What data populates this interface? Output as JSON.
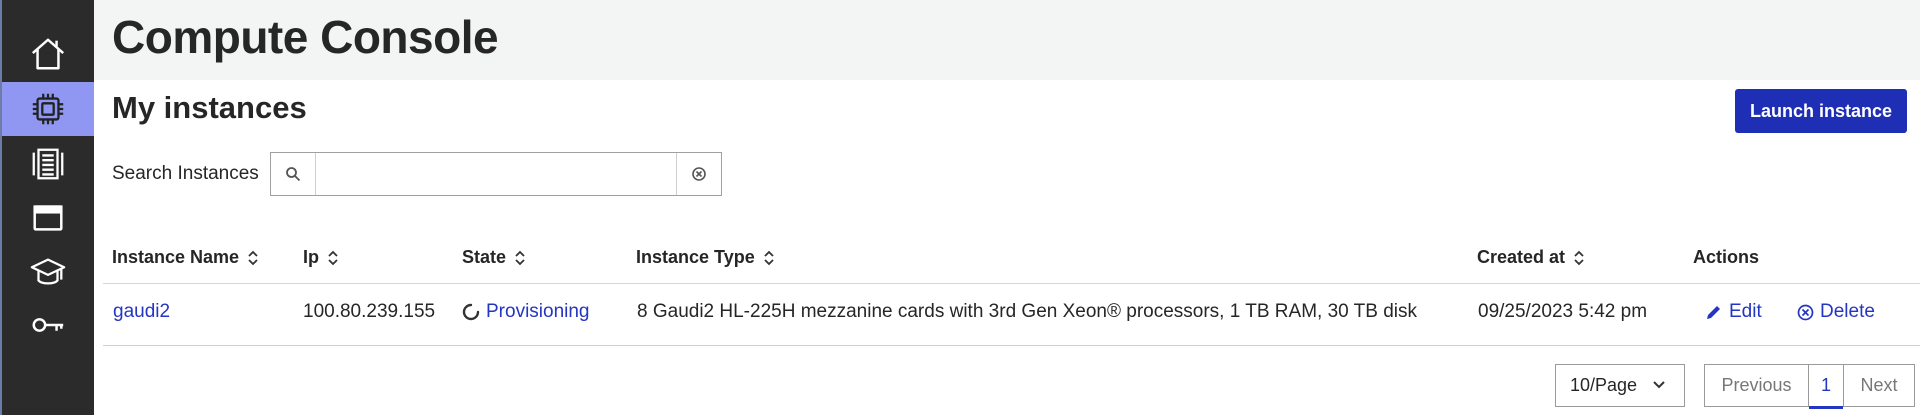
{
  "header": {
    "title": "Compute Console"
  },
  "sidebar": {
    "items": [
      {
        "name": "home",
        "icon": "home-icon",
        "active": false
      },
      {
        "name": "compute",
        "icon": "cpu-chip-icon",
        "active": true
      },
      {
        "name": "storage",
        "icon": "storage-rack-icon",
        "active": false
      },
      {
        "name": "window",
        "icon": "window-icon",
        "active": false
      },
      {
        "name": "learning",
        "icon": "graduation-cap-icon",
        "active": false
      },
      {
        "name": "keys",
        "icon": "key-icon",
        "active": false
      }
    ]
  },
  "main": {
    "title": "My instances",
    "launch_button": "Launch instance",
    "search": {
      "label": "Search Instances",
      "value": "",
      "placeholder": ""
    }
  },
  "table": {
    "columns": [
      "Instance Name",
      "Ip",
      "State",
      "Instance Type",
      "Created at",
      "Actions"
    ],
    "rows": [
      {
        "name": "gaudi2",
        "ip": "100.80.239.155",
        "state": "Provisioning",
        "type": "8 Gaudi2 HL-225H mezzanine cards with 3rd Gen Xeon® processors, 1 TB RAM, 30 TB disk",
        "created": "09/25/2023 5:42 pm",
        "edit": "Edit",
        "delete": "Delete"
      }
    ]
  },
  "pagination": {
    "page_size": "10/Page",
    "previous": "Previous",
    "current": "1",
    "next": "Next"
  },
  "colors": {
    "sidebar": "#2b2b2b",
    "active_nav": "#8f97f2",
    "primary": "#1f2fb5",
    "link": "#2435c2",
    "header_bg": "#f3f4f4"
  }
}
